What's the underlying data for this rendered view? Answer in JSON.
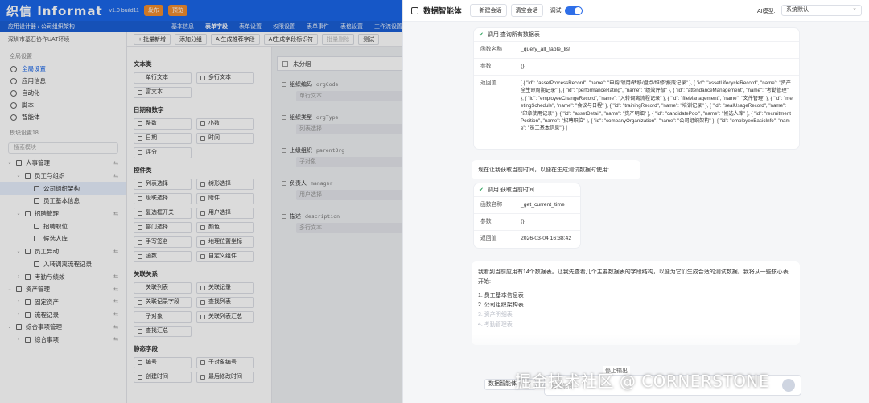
{
  "app": {
    "logo": "织信 Informat",
    "version": "v1.0 build11",
    "publish_label": "发布",
    "preview_label": "预览"
  },
  "subbar": {
    "breadcrumb": "应用设计器 / 公司组织架构",
    "tabs": [
      "基本信息",
      "表单字段",
      "表单设置",
      "权限设置",
      "表单事件",
      "表格设置",
      "工作流设置"
    ]
  },
  "sidebar": {
    "org": "深圳市基石协作UAT环境",
    "global_title": "全局设置",
    "global_items": [
      "全局设置",
      "应用信息",
      "自动化",
      "脚本",
      "智能体"
    ],
    "module_title": "模块设置18",
    "search_placeholder": "搜索模块",
    "menu": [
      {
        "label": "人事管理",
        "level": 0,
        "tw": "⌄",
        "sel": false
      },
      {
        "label": "员工与组织",
        "level": 1,
        "tw": "⌄",
        "sel": false
      },
      {
        "label": "公司组织架构",
        "level": 2,
        "tw": "",
        "sel": true
      },
      {
        "label": "员工基本信息",
        "level": 2,
        "tw": "",
        "sel": false
      },
      {
        "label": "招聘管理",
        "level": 1,
        "tw": "⌄",
        "sel": false
      },
      {
        "label": "招聘职位",
        "level": 2,
        "tw": "",
        "sel": false
      },
      {
        "label": "候选人库",
        "level": 2,
        "tw": "",
        "sel": false
      },
      {
        "label": "员工异动",
        "level": 1,
        "tw": "⌄",
        "sel": false
      },
      {
        "label": "入转调离流程记录",
        "level": 2,
        "tw": "",
        "sel": false
      },
      {
        "label": "考勤与绩效",
        "level": 1,
        "tw": "›",
        "sel": false
      },
      {
        "label": "资产管理",
        "level": 0,
        "tw": "⌄",
        "sel": false
      },
      {
        "label": "固定资产",
        "level": 1,
        "tw": "›",
        "sel": false
      },
      {
        "label": "流程记录",
        "level": 1,
        "tw": "›",
        "sel": false
      },
      {
        "label": "综合事项管理",
        "level": 0,
        "tw": "⌄",
        "sel": false
      },
      {
        "label": "综合事项",
        "level": 1,
        "tw": "›",
        "sel": false
      }
    ]
  },
  "toolbar": {
    "buttons": [
      "+ 批量新增",
      "添加分组",
      "AI生成推荐字段",
      "AI生成字段标识符",
      "批量删除",
      "测试"
    ]
  },
  "palette": {
    "categories": [
      {
        "title": "文本类",
        "items": [
          "单行文本",
          "多行文本",
          "富文本"
        ]
      },
      {
        "title": "日期和数字",
        "items": [
          "整数",
          "小数",
          "日期",
          "时间",
          "评分"
        ]
      },
      {
        "title": "控件类",
        "items": [
          "列表选择",
          "树形选择",
          "级联选择",
          "附件",
          "复选框开关",
          "用户选择",
          "部门选择",
          "颜色",
          "手写签名",
          "地理位置坐标",
          "函数",
          "自定义组件"
        ]
      },
      {
        "title": "关联关系",
        "items": [
          "关联列表",
          "关联记录",
          "关联记录字段",
          "查找列表",
          "子对象",
          "关联列表汇总",
          "查找汇总"
        ]
      },
      {
        "title": "静态字段",
        "items": [
          "编号",
          "子对象编号",
          "创建时间",
          "最后修改时间"
        ]
      }
    ]
  },
  "canvas": {
    "group": "未分组",
    "fields": [
      {
        "label": "组织编码",
        "code": "orgCode",
        "placeholder": "单行文本"
      },
      {
        "label": "组织类型",
        "code": "orgType",
        "placeholder": "列表选择"
      },
      {
        "label": "上级组织",
        "code": "parentOrg",
        "placeholder": "子对象"
      },
      {
        "label": "负责人",
        "code": "manager",
        "placeholder": "用户选择"
      },
      {
        "label": "描述",
        "code": "description",
        "placeholder": "多行文本"
      }
    ]
  },
  "panel": {
    "title": "数据智能体",
    "new_chat": "+ 新建会话",
    "clear_chat": "清空会话",
    "debug": "调试",
    "model_label": "AI模型:",
    "model_value": "系统默认",
    "tool1": {
      "header": "调用 查询所有数据表",
      "name_key": "函数名称",
      "name_val": "_query_all_table_list",
      "param_key": "参数",
      "param_val": "{}",
      "ret_key": "返回值",
      "ret_val": "[ { \"id\": \"assetProcessRecord\", \"name\": \"申购/领用/转移/盘点/维修/报废记录\" }, { \"id\": \"assetLifecycleRecord\", \"name\": \"资产全生命周期记录\" }, { \"id\": \"performanceRating\", \"name\": \"绩效评级\" }, { \"id\": \"attendanceManagement\", \"name\": \"考勤管理\" }, { \"id\": \"employeeChangeRecord\", \"name\": \"入转调离流程记录\" }, { \"id\": \"fileManagement\", \"name\": \"文件管理\" }, { \"id\": \"meetingSchedule\", \"name\": \"会议与日程\" }, { \"id\": \"trainingRecord\", \"name\": \"培训记录\" }, { \"id\": \"sealUsageRecord\", \"name\": \"印章使用记录\" }, { \"id\": \"assetDetail\", \"name\": \"资产明细\" }, { \"id\": \"candidatePool\", \"name\": \"候选人库\" }, { \"id\": \"recruitmentPosition\", \"name\": \"招聘职位\" }, { \"id\": \"companyOrganization\", \"name\": \"公司组织架构\" }, { \"id\": \"employeeBasicInfo\", \"name\": \"员工基本信息\" } ]"
    },
    "msg1": "现在让我获取当前时间，以便在生成测试数据时使用:",
    "tool2": {
      "header": "调用 获取当前时间",
      "name_key": "函数名称",
      "name_val": "_get_current_time",
      "param_key": "参数",
      "param_val": "{}",
      "ret_key": "返回值",
      "ret_val": "2026-03-04 16:38:42"
    },
    "msg2": {
      "intro": "我看到当前应用有14个数据表。让我先查看几个主要数据表的字段结构，以便为它们生成合适的测试数据。我将从一些核心表开始:",
      "items": [
        "1. 员工基本信息表",
        "2. 公司组织架构表",
        "3. 资产明细表",
        "4. 考勤管理表"
      ]
    },
    "stop": "停止输出",
    "bottom_model": "数据智能体",
    "input_placeholder": "为智能体..."
  },
  "watermark": "掘金技术社区 @ CORNERSTONE"
}
